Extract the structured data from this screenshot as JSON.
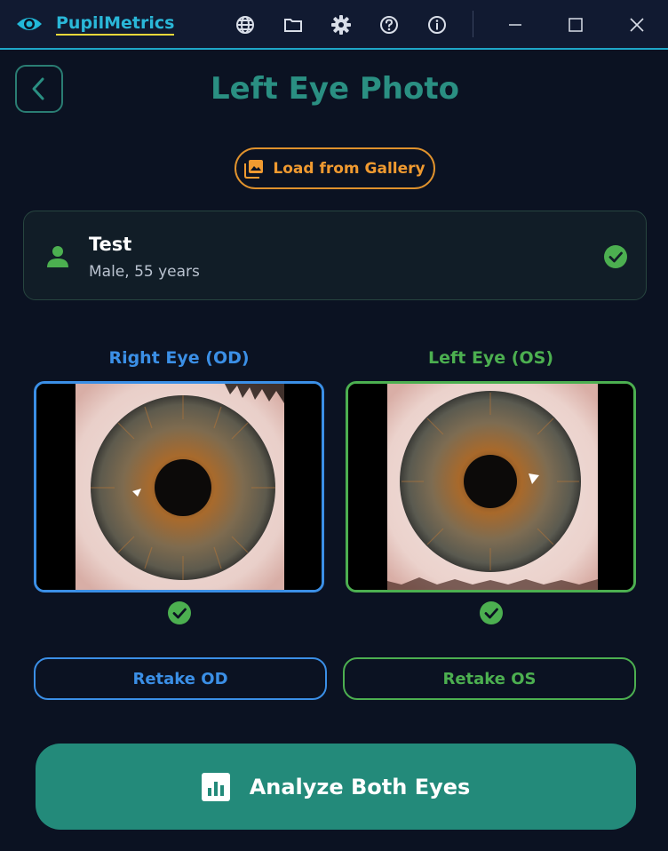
{
  "app": {
    "title": "PupilMetrics"
  },
  "titlebar": {
    "icons": [
      "globe-icon",
      "folder-icon",
      "gear-icon",
      "help-icon",
      "info-icon"
    ],
    "window_controls": [
      "minimize-icon",
      "maximize-icon",
      "close-icon"
    ]
  },
  "header": {
    "title": "Left Eye Photo"
  },
  "gallery": {
    "label": "Load from Gallery"
  },
  "patient": {
    "name": "Test",
    "meta": "Male, 55 years",
    "verified": true
  },
  "eyes": {
    "right": {
      "label": "Right Eye (OD)",
      "captured": true,
      "retake_label": "Retake OD",
      "color": "#3b8fe6"
    },
    "left": {
      "label": "Left Eye (OS)",
      "captured": true,
      "retake_label": "Retake OS",
      "color": "#4caf50"
    }
  },
  "analyze": {
    "label": "Analyze Both Eyes"
  },
  "colors": {
    "accent_teal": "#238a7a",
    "orange": "#f09a30",
    "cyan": "#2ab7d8",
    "success": "#4caf50"
  }
}
